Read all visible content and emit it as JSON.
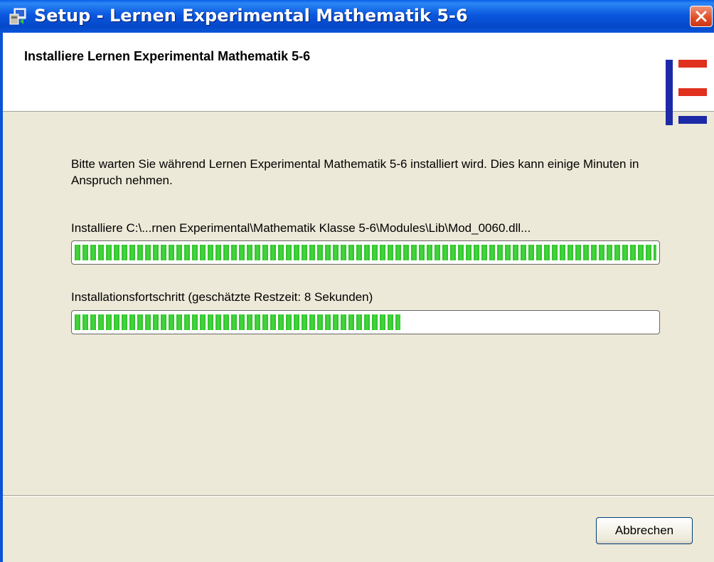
{
  "window": {
    "title": "Setup - Lernen Experimental Mathematik 5-6"
  },
  "header": {
    "title": "Installiere Lernen Experimental Mathematik 5-6"
  },
  "main": {
    "description": "Bitte warten Sie während Lernen Experimental Mathematik 5-6 installiert wird. Dies kann einige Minuten in Anspruch nehmen.",
    "file_label": "Installiere C:\\...rnen Experimental\\Mathematik Klasse 5-6\\Modules\\Lib\\Mod_0060.dll...",
    "file_progress": 1.0,
    "overall_label": "Installationsfortschritt (geschätzte Restzeit: 8 Sekunden)",
    "overall_progress": 0.56
  },
  "buttons": {
    "cancel": "Abbrechen"
  },
  "icons": [
    "setup-app-icon",
    "close-icon",
    "brand-logo-icon"
  ],
  "colors": {
    "progress_fill": "#2fbf2a",
    "titlebar": "#0b58e0",
    "logo_blue": "#1c2aa8",
    "logo_red": "#e0301e"
  }
}
